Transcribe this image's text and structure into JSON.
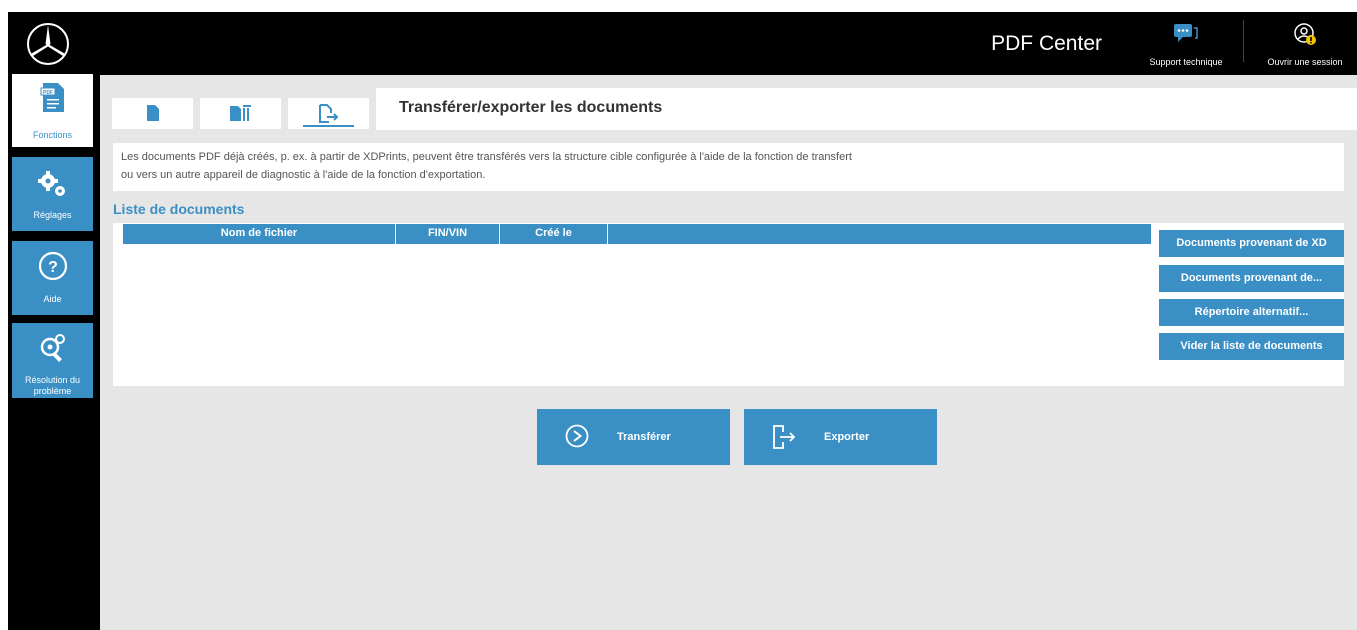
{
  "header": {
    "app_title": "PDF Center",
    "support_label": "Support technique",
    "login_label": "Ouvrir une session"
  },
  "sidebar": {
    "items": [
      {
        "label": "Fonctions",
        "icon": "pdf-document-icon",
        "active": true
      },
      {
        "label": "Réglages",
        "icon": "gears-icon",
        "active": false
      },
      {
        "label": "Aide",
        "icon": "help-icon",
        "active": false
      },
      {
        "label": "Résolution du problème",
        "icon": "troubleshoot-icon",
        "active": false
      }
    ]
  },
  "tabs": [
    {
      "icon": "document-icon"
    },
    {
      "icon": "documents-stack-icon"
    },
    {
      "icon": "document-export-icon",
      "active": true
    }
  ],
  "page": {
    "title": "Transférer/exporter les documents",
    "description_line1": "Les documents PDF déjà créés, p. ex. à partir de XDPrints, peuvent être transférés vers la structure cible configurée à l'aide de la fonction de transfert",
    "description_line2": "ou vers un autre appareil de diagnostic à l'aide de la fonction d'exportation.",
    "list_title": "Liste de documents"
  },
  "table": {
    "columns": [
      "Nom de fichier",
      "FIN/VIN",
      "Créé le"
    ],
    "rows": []
  },
  "side_buttons": {
    "xd": "Documents provenant de XD",
    "from": "Documents provenant de...",
    "alt": "Répertoire alternatif...",
    "clear": "Vider la liste de documents"
  },
  "actions": {
    "transfer": "Transférer",
    "export": "Exporter"
  },
  "colors": {
    "accent": "#3a8fc5",
    "background": "#e6e6e6",
    "sidebar": "#000000"
  }
}
